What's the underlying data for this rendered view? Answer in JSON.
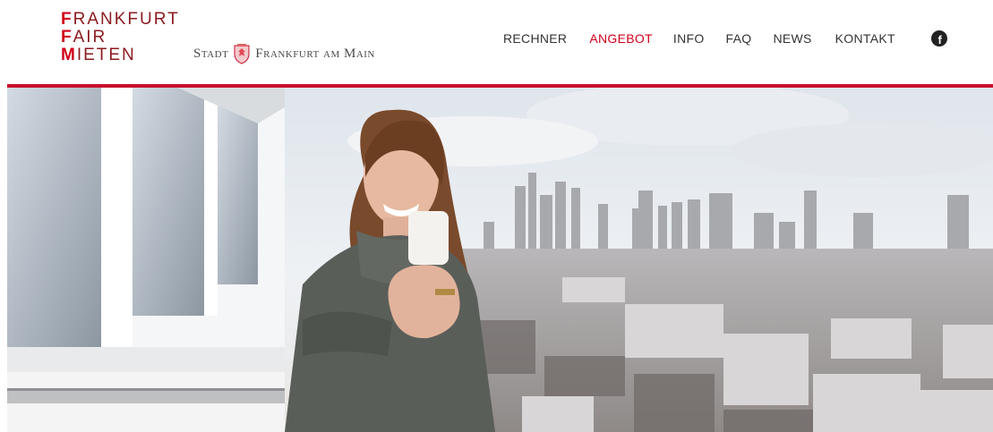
{
  "logo": {
    "lines": [
      {
        "cap": "F",
        "rest": "RANKFURT"
      },
      {
        "cap": "F",
        "rest": "AIR"
      },
      {
        "cap": "M",
        "rest": "IETEN"
      }
    ]
  },
  "city": {
    "stadt": "Stadt",
    "name": "Frankfurt am Main"
  },
  "nav": {
    "items": [
      "RECHNER",
      "ANGEBOT",
      "INFO",
      "FAQ",
      "NEWS",
      "KONTAKT"
    ],
    "active": "ANGEBOT",
    "social_icon": "facebook-icon"
  },
  "colors": {
    "accent": "#d0021b",
    "rule": "#c8102e"
  },
  "hero": {
    "description_icon": "hero-photo"
  }
}
